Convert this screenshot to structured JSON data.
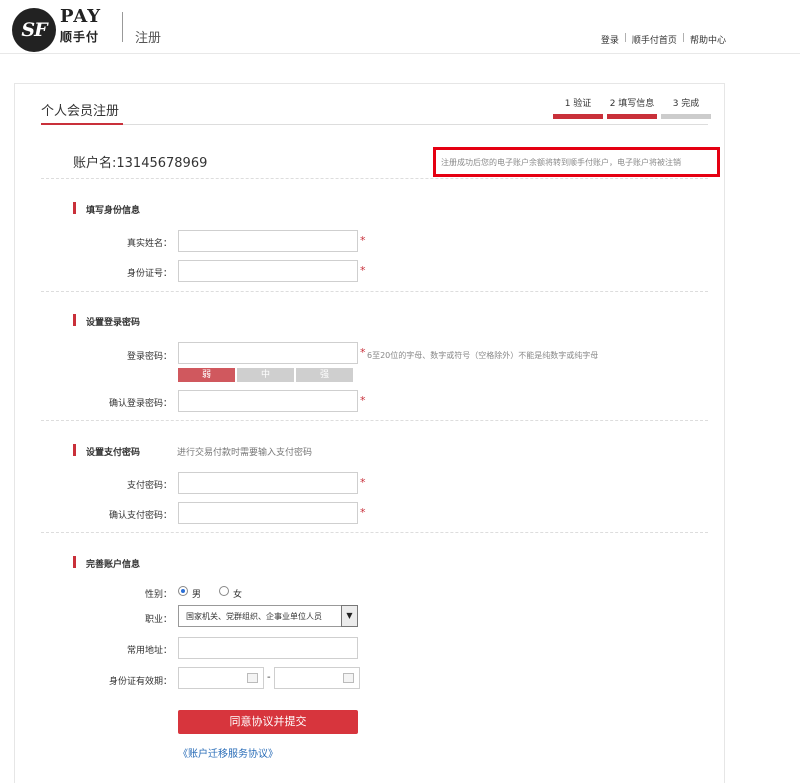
{
  "header": {
    "logo_mark": "SF",
    "logo_pay": "PAY",
    "logo_cn": "顺手付",
    "title": "注册",
    "links": [
      "登录",
      "顺手付首页",
      "帮助中心"
    ],
    "link_separator": "|"
  },
  "card": {
    "title": "个人会员注册",
    "steps": [
      {
        "label": "1 验证",
        "active": true
      },
      {
        "label": "2 填写信息",
        "active": true
      },
      {
        "label": "3 完成",
        "active": false
      }
    ],
    "account": "账户名:13145678969",
    "notice": "注册成功后您的电子账户余额将转到顺手付账户，电子账户将被注销"
  },
  "identity": {
    "title": "填写身份信息",
    "real_name_label": "真实姓名：",
    "id_number_label": "身份证号："
  },
  "login_password": {
    "title": "设置登录密码",
    "password_label": "登录密码：",
    "password_hint": "6至20位的字母、数字或符号（空格除外）不能是纯数字或纯字母",
    "strength": [
      "弱",
      "中",
      "强"
    ],
    "confirm_label": "确认登录密码："
  },
  "pay_password": {
    "title": "设置支付密码",
    "hint": "进行交易付款时需要输入支付密码",
    "password_label": "支付密码：",
    "confirm_label": "确认支付密码："
  },
  "account_info": {
    "title": "完善账户信息",
    "gender_label": "性别：",
    "gender_options": [
      "男",
      "女"
    ],
    "gender_selected": "男",
    "occupation_label": "职业：",
    "occupation_value": "国家机关、党群组织、企事业单位人员",
    "address_label": "常用地址：",
    "id_expiry_label": "身份证有效期：",
    "date_separator": "-"
  },
  "required_mark": "*",
  "submit_label": "同意协议并提交",
  "agreement_link": "《账户迁移服务协议》",
  "colors": {
    "accent": "#c9303a",
    "notice_border": "#e50012",
    "link": "#2a6db8"
  }
}
